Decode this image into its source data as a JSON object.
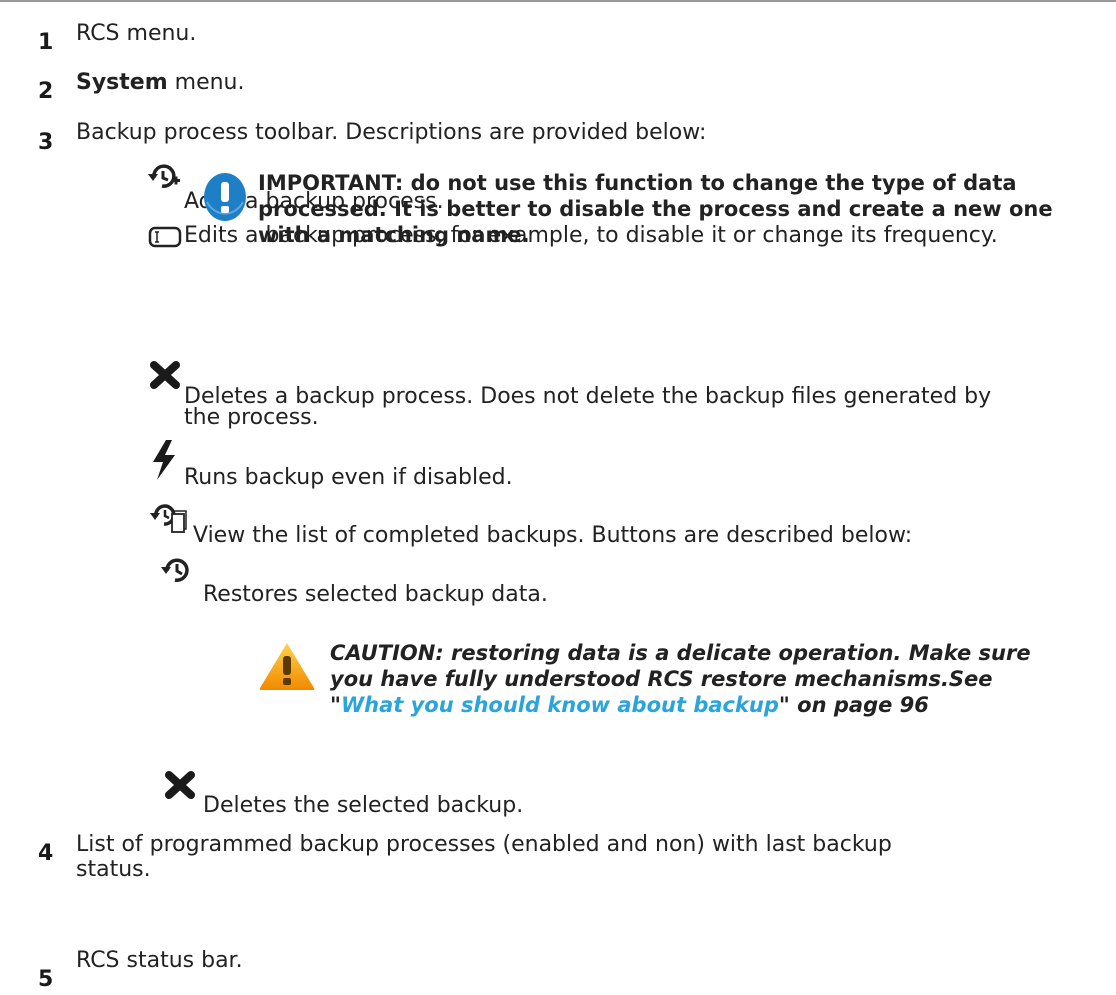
{
  "items": [
    {
      "num": "1",
      "text": "RCS menu."
    },
    {
      "num": "2",
      "bold_prefix": "System",
      "text": " menu."
    },
    {
      "num": "3",
      "text": "Backup process toolbar. Descriptions are provided below:"
    },
    {
      "num": "4",
      "text_line1": "List of programmed backup processes (enabled and non) with last backup",
      "text_line2": "status."
    },
    {
      "num": "5",
      "text": "RCS status bar."
    }
  ],
  "toolbar": {
    "add": {
      "icon": "add-backup-icon",
      "text": "Adds a backup process."
    },
    "edit": {
      "icon": "edit-icon",
      "text": "Edits a backup process, for example, to disable it or change its frequency."
    },
    "important": {
      "icon": "important-icon",
      "text": "IMPORTANT: do not use this function to change the type of data processed. It is better to disable the process and create a new one with a matching name."
    },
    "delete": {
      "icon": "delete-icon",
      "text_line1": "Deletes a backup process. Does not delete the backup files generated by",
      "text_line2": "the process."
    },
    "run": {
      "icon": "lightning-icon",
      "text": "Runs backup even if disabled."
    },
    "view": {
      "icon": "view-backups-icon",
      "text": "View the list of completed backups. Buttons are described below:"
    },
    "restore": {
      "icon": "restore-icon",
      "text": "Restores selected backup data."
    },
    "caution": {
      "icon": "caution-icon",
      "text_line1": "CAUTION: restoring data is a delicate operation. Make sure",
      "text_line2": "you have fully understood RCS restore mechanisms.See",
      "quote_open": "\"",
      "link": "What you should know about backup",
      "quote_close": "\" on page 96"
    },
    "delete_selected": {
      "icon": "delete-icon",
      "text": "Deletes the selected backup."
    }
  },
  "colors": {
    "link": "#2aa4dd",
    "important_blue": "#1e7fc6",
    "caution_orange": "#f5a623"
  }
}
